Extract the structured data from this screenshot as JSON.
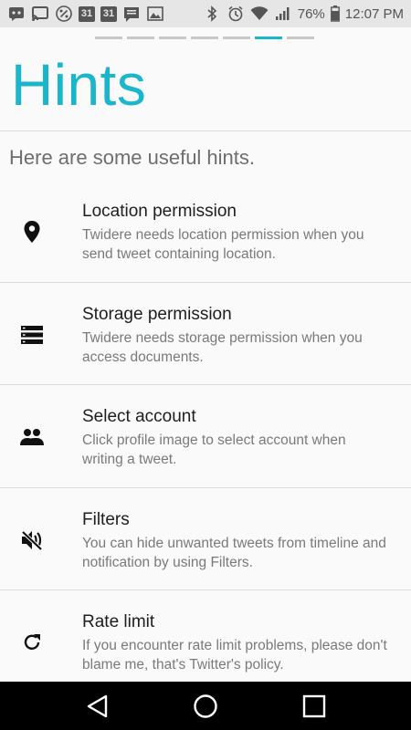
{
  "status_bar": {
    "battery_percent": "76%",
    "time": "12:07 PM",
    "calendar_day_1": "31",
    "calendar_day_2": "31",
    "icons_left": [
      "hangouts-icon",
      "cast-icon",
      "percent-icon",
      "calendar-icon",
      "calendar-icon",
      "message-icon",
      "photo-icon"
    ],
    "icons_right": [
      "bluetooth-icon",
      "alarm-icon",
      "wifi-icon",
      "signal-icon",
      "battery-icon"
    ]
  },
  "pager": {
    "count": 7,
    "active_index": 5
  },
  "header": {
    "title": "Hints"
  },
  "intro": {
    "text": "Here are some useful hints."
  },
  "hints": [
    {
      "icon": "location-pin-icon",
      "title": "Location permission",
      "description": "Twidere needs location permission when you send tweet containing location."
    },
    {
      "icon": "storage-icon",
      "title": "Storage permission",
      "description": "Twidere needs storage permission when you access documents."
    },
    {
      "icon": "people-icon",
      "title": "Select account",
      "description": "Click profile image to select account when writing a tweet."
    },
    {
      "icon": "volume-off-icon",
      "title": "Filters",
      "description": "You can hide unwanted tweets from timeline and notification by using Filters."
    },
    {
      "icon": "refresh-icon",
      "title": "Rate limit",
      "description": "If you encounter rate limit problems, please don't blame me, that's Twitter's policy."
    }
  ],
  "nav_bar": {
    "buttons": [
      "back-icon",
      "home-icon",
      "recents-icon"
    ]
  },
  "colors": {
    "accent": "#1ab7cc",
    "status_bar_bg": "#e6e6e6",
    "nav_bar_bg": "#000000"
  }
}
